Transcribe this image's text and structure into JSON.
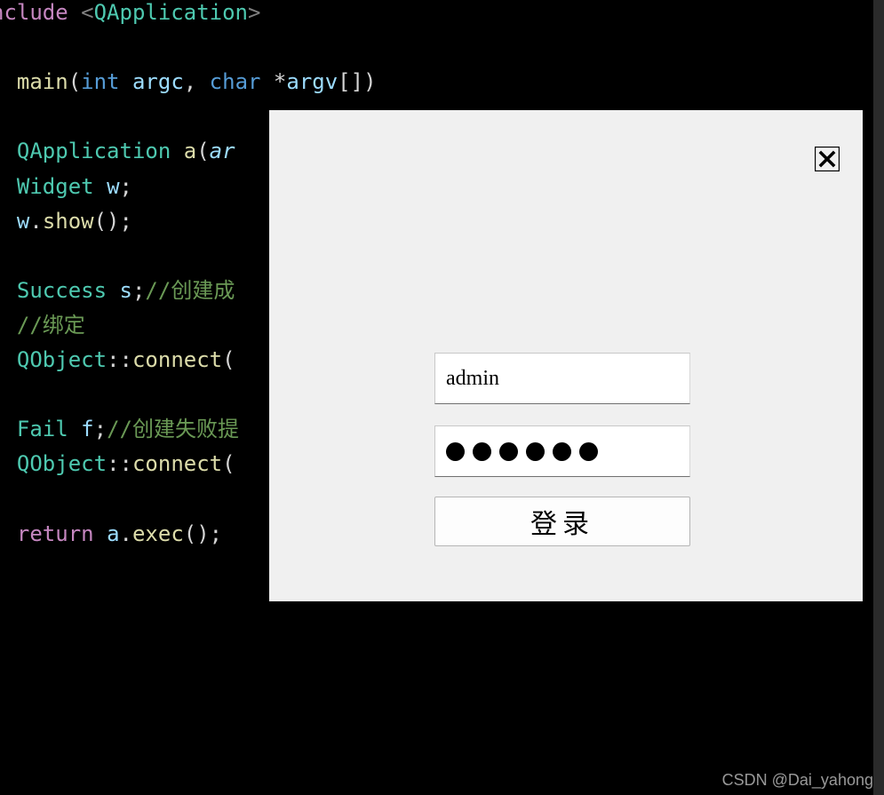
{
  "code": {
    "line1_include": "nclude",
    "line1_header": "QApplication",
    "line2_funcname": "main",
    "line2_kw_int": "int",
    "line2_param_argc": "argc",
    "line2_kw_char": "char",
    "line2_star": "*",
    "line2_param_argv": "argv",
    "line2_brackets": "[]",
    "line3_type": "QApplication",
    "line3_var": "a",
    "line3_param": "ar",
    "line4_type": "Widget",
    "line4_var": "w",
    "line5_var": "w",
    "line5_method": "show",
    "line6_type": "Success",
    "line6_var": "s",
    "line6_comment": "//创建成",
    "line7_comment": "//绑定",
    "line8_type": "QObject",
    "line8_method": "connect",
    "line9_type": "Fail",
    "line9_var": "f",
    "line9_comment": "//创建失败提",
    "line10_type": "QObject",
    "line10_method": "connect",
    "line11_kw": "return",
    "line11_var": "a",
    "line11_method": "exec"
  },
  "dialog": {
    "username_value": "admin",
    "password_dots": 6,
    "login_button_label": "登录"
  },
  "watermark": "CSDN @Dai_yahong"
}
